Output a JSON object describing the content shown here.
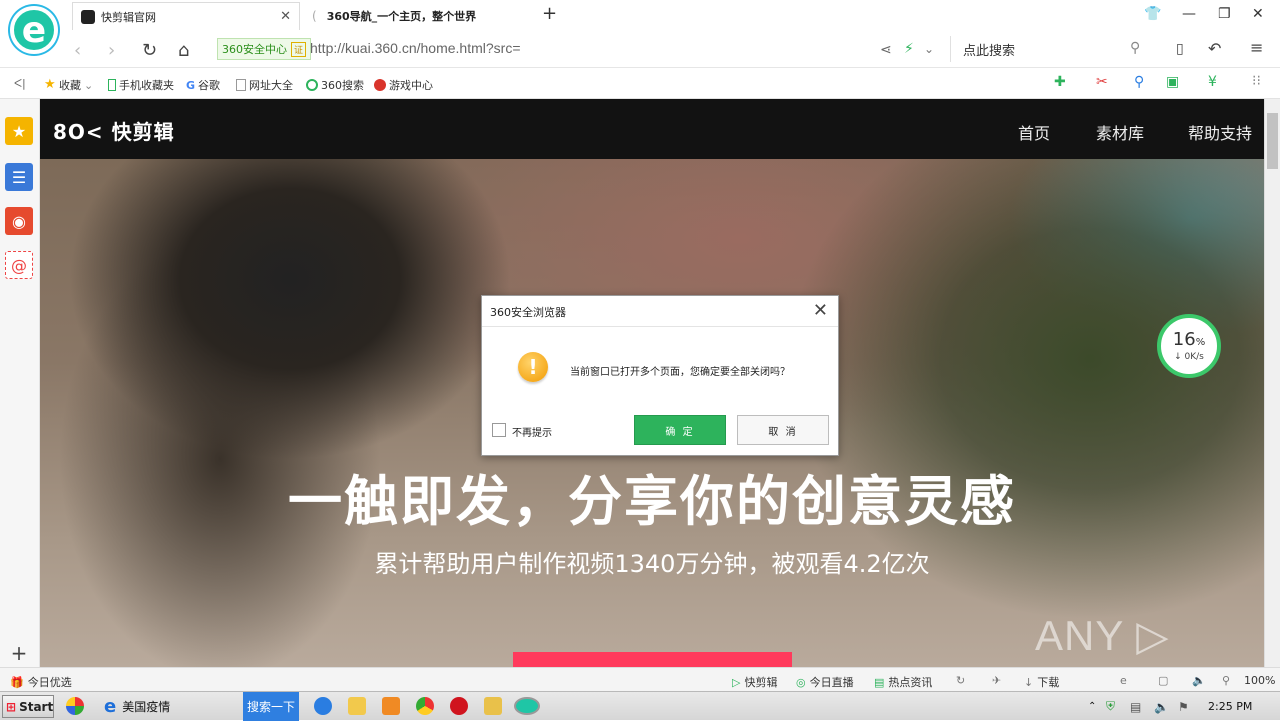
{
  "browser": {
    "tabs": [
      {
        "title": "快剪辑官网",
        "active": true
      },
      {
        "title": "360导航_一个主页，整个世界",
        "active": false
      }
    ],
    "security_badge": "360安全中心",
    "security_mark": "证",
    "url": "http://kuai.360.cn/home.html?src=",
    "search_placeholder": "点此搜索",
    "bookmarks": [
      {
        "label": "收藏",
        "icon": "star-icon"
      },
      {
        "label": "手机收藏夹",
        "icon": "phone-icon"
      },
      {
        "label": "谷歌",
        "icon": "google-icon"
      },
      {
        "label": "网址大全",
        "icon": "page-icon"
      },
      {
        "label": "360搜索",
        "icon": "search360-icon"
      },
      {
        "label": "游戏中心",
        "icon": "game-icon"
      }
    ]
  },
  "site": {
    "logo": "8O< 快剪辑",
    "nav": [
      "首页",
      "素材库",
      "帮助支持"
    ],
    "hero_title": "一触即发，分享你的创意灵感",
    "hero_subtitle": "累计帮助用户制作视频1340万分钟，被观看4.2亿次",
    "watermark": "ANY ▷ RUN"
  },
  "speed_widget": {
    "percent": "16",
    "percent_sign": "%",
    "rate": "↓ 0K/s"
  },
  "dialog": {
    "title": "360安全浏览器",
    "message": "当前窗口已打开多个页面，您确定要全部关闭吗？",
    "checkbox_label": "不再提示",
    "ok_label": "确 定",
    "cancel_label": "取 消"
  },
  "statusbar": {
    "left": "今日优选",
    "items": [
      "快剪辑",
      "今日直播",
      "热点资讯",
      "下载"
    ],
    "zoom": "100%"
  },
  "taskbar": {
    "start": "Start",
    "window_title": "美国疫情",
    "search_button": "搜索一下",
    "clock": "2:25 PM"
  },
  "colors": {
    "accent_green": "#2db35c",
    "hero_button": "#ff3a5c",
    "header_bg": "#121212"
  }
}
